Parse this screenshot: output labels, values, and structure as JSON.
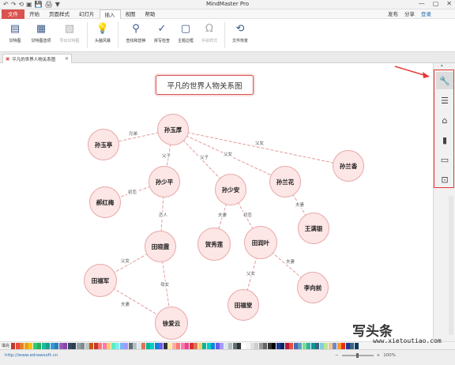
{
  "app": {
    "title": "MindMaster Pro"
  },
  "quick_access": [
    "↶",
    "↷",
    "⟲",
    "▣",
    "💾",
    "🖨",
    "▼"
  ],
  "window_controls": [
    "—",
    "▢",
    "✕"
  ],
  "menu": {
    "file": "文件",
    "items": [
      "开始",
      "页面样式",
      "幻灯片",
      "插入",
      "视图",
      "帮助"
    ],
    "active_index": 3,
    "right": {
      "publish": "发布",
      "share": "分享",
      "login": "登录"
    }
  },
  "ribbon": [
    {
      "label": "甘特图",
      "icon": "gantt-icon",
      "glyph": "▤",
      "disabled": false
    },
    {
      "label": "甘特图选项",
      "icon": "gantt-options-icon",
      "glyph": "▦",
      "disabled": false
    },
    {
      "label": "导出甘特图",
      "icon": "export-gantt-icon",
      "glyph": "▧",
      "disabled": true
    },
    {
      "label": "头脑风暴",
      "icon": "brainstorm-icon",
      "glyph": "💡",
      "disabled": false
    },
    {
      "label": "查找和替换",
      "icon": "binoculars-icon",
      "glyph": "⚲",
      "disabled": false
    },
    {
      "label": "拼写检查",
      "icon": "spellcheck-icon",
      "glyph": "✓",
      "disabled": false
    },
    {
      "label": "主题边框",
      "icon": "theme-border-icon",
      "glyph": "▢",
      "disabled": false
    },
    {
      "label": "手绘样式",
      "icon": "omega-icon",
      "glyph": "Ω",
      "disabled": true
    },
    {
      "label": "文件恢复",
      "icon": "file-recovery-icon",
      "glyph": "⟲",
      "disabled": false
    }
  ],
  "doc_tab": {
    "label": "平凡的世界人物关系图",
    "close": "✕"
  },
  "diagram": {
    "title": "平凡的世界人物关系图",
    "nodes": [
      {
        "id": "n1",
        "label": "孙玉厚"
      },
      {
        "id": "n2",
        "label": "孙玉亭"
      },
      {
        "id": "n3",
        "label": "孙少平"
      },
      {
        "id": "n4",
        "label": "孙少安"
      },
      {
        "id": "n5",
        "label": "孙兰花"
      },
      {
        "id": "n6",
        "label": "孙兰香"
      },
      {
        "id": "n7",
        "label": "郝红梅"
      },
      {
        "id": "n8",
        "label": "田晓霞"
      },
      {
        "id": "n9",
        "label": "贺秀莲"
      },
      {
        "id": "n10",
        "label": "田润叶"
      },
      {
        "id": "n11",
        "label": "王满银"
      },
      {
        "id": "n12",
        "label": "田福军"
      },
      {
        "id": "n13",
        "label": "李向前"
      },
      {
        "id": "n14",
        "label": "田福堂"
      },
      {
        "id": "n15",
        "label": "徐爱云"
      }
    ],
    "relations": [
      "兄弟",
      "父女",
      "父子",
      "父子",
      "父女",
      "初恋",
      "恋人",
      "夫妻",
      "初恋",
      "夫妻",
      "父女",
      "夫妻",
      "父女",
      "母女",
      "夫妻"
    ]
  },
  "side_panel": {
    "icons": [
      {
        "name": "format-brush-icon",
        "glyph": "🔧"
      },
      {
        "name": "outline-icon",
        "glyph": "☰"
      },
      {
        "name": "clipart-icon",
        "glyph": "⌂"
      },
      {
        "name": "attachment-icon",
        "glyph": "▮"
      },
      {
        "name": "calendar-icon",
        "glyph": "▭"
      },
      {
        "name": "export-icon",
        "glyph": "⊡"
      }
    ]
  },
  "palette": {
    "label": "填充",
    "colors": [
      "#c0392b",
      "#e74c3c",
      "#e67e22",
      "#f39c12",
      "#f1c40f",
      "#2ecc71",
      "#27ae60",
      "#1abc9c",
      "#16a085",
      "#3498db",
      "#2980b9",
      "#9b59b6",
      "#8e44ad",
      "#34495e",
      "#2c3e50",
      "#95a5a6",
      "#7f8c8d",
      "#bdc3c7",
      "#d35400",
      "#c0392b",
      "#ff7675",
      "#fd79a8",
      "#fdcb6e",
      "#55efc4",
      "#81ecec",
      "#74b9ff",
      "#a29bfe",
      "#636e72",
      "#b2bec3",
      "#dfe6e9",
      "#e17055",
      "#00b894",
      "#00cec9",
      "#0984e3",
      "#6c5ce7",
      "#2d3436",
      "#ffeaa7",
      "#fab1a0",
      "#ff7675",
      "#fd79a8",
      "#e84393",
      "#d63031",
      "#e17055",
      "#fdcb6e",
      "#00b894",
      "#00cec9",
      "#0984e3",
      "#6c5ce7",
      "#a29bfe",
      "#dfe6e9",
      "#b2bec3",
      "#636e72",
      "#2d3436",
      "#ffffff",
      "#f5f5f5",
      "#e0e0e0",
      "#cccccc",
      "#999999",
      "#666666",
      "#333333",
      "#000000",
      "#1e3799",
      "#0c2461",
      "#b71540",
      "#e55039",
      "#4a69bd",
      "#60a3bc",
      "#78e08f",
      "#38ada9",
      "#079992",
      "#3c6382",
      "#82ccdd",
      "#b8e994",
      "#f8c291",
      "#6a89cc",
      "#fa983a",
      "#eb2f06",
      "#1e3799",
      "#3c6382",
      "#0a3d62"
    ]
  },
  "status": {
    "url": "http://www.edrawsoft.cn",
    "zoom": "100%"
  },
  "watermark": {
    "logo": "写头条",
    "url": "www.xietoutiao.com"
  }
}
